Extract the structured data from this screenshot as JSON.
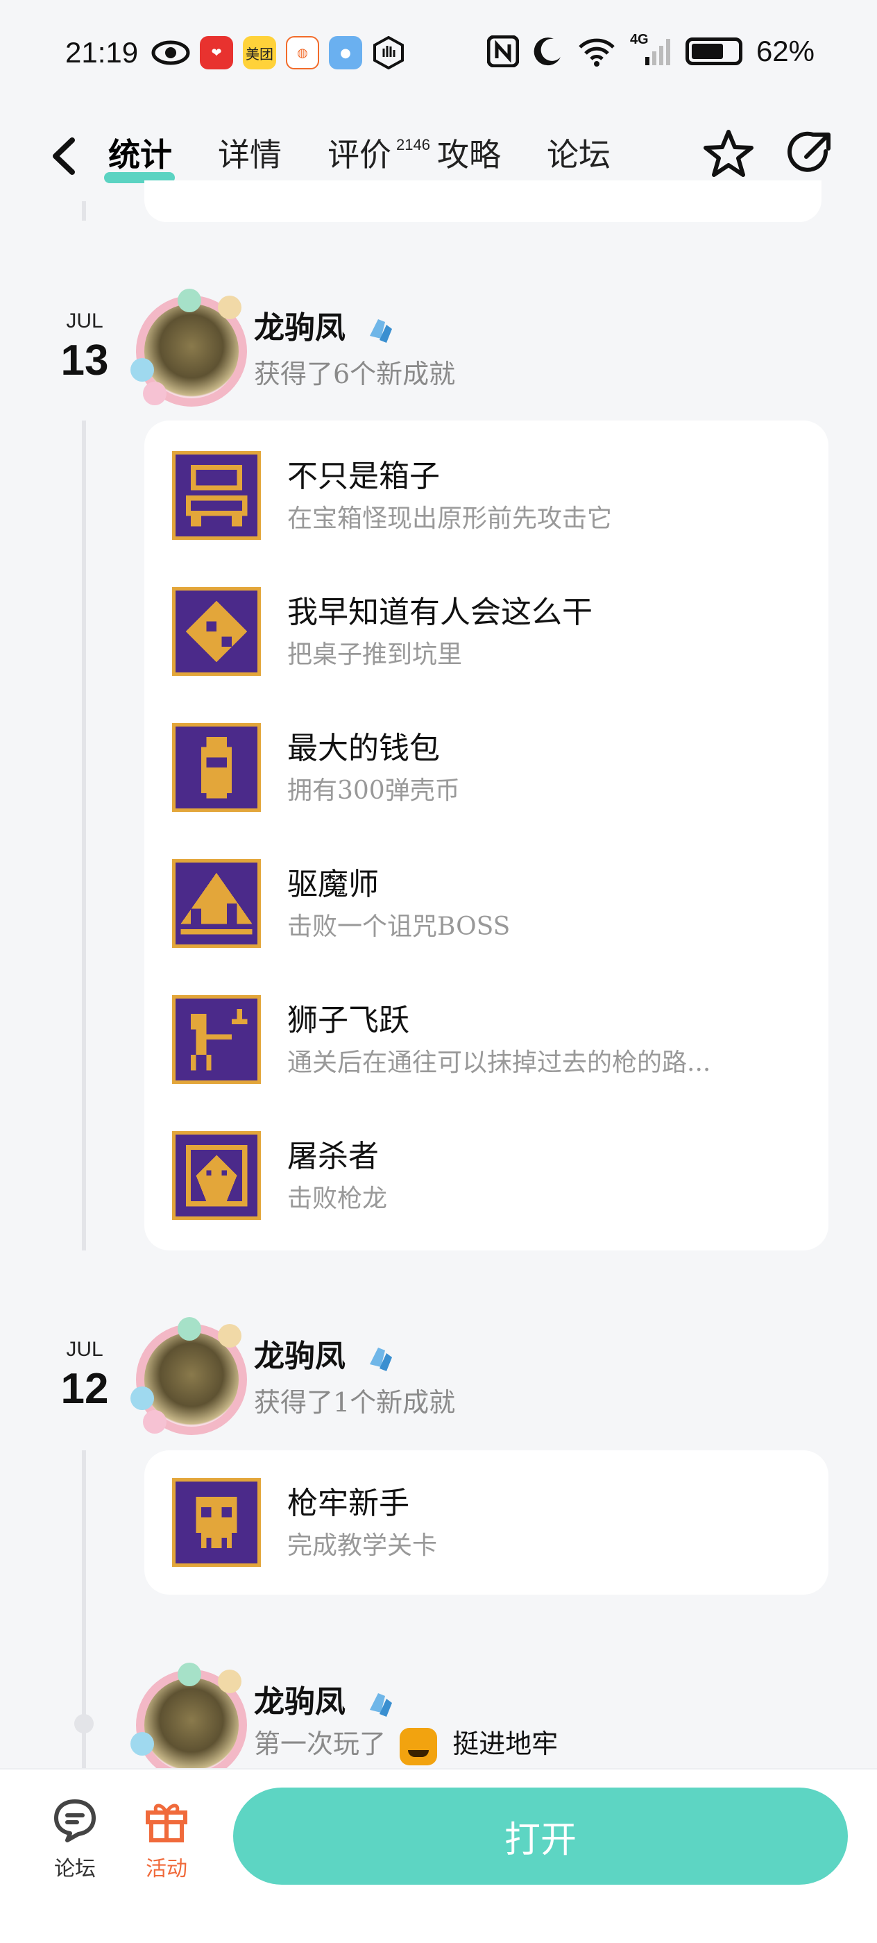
{
  "status_bar": {
    "time": "21:19",
    "apps": [
      "eye-icon",
      "red-app",
      "美团",
      "didi-app",
      "weather-app",
      "hand-icon"
    ],
    "network": "4G",
    "battery": "62%",
    "battery_level": 0.62
  },
  "nav": {
    "tabs": [
      {
        "label": "统计",
        "active": true
      },
      {
        "label": "详情"
      },
      {
        "label": "评价",
        "badge": "2146"
      },
      {
        "label": "攻略"
      },
      {
        "label": "论坛"
      }
    ]
  },
  "entries": [
    {
      "month": "JUL",
      "day": "13",
      "user": "龙驹凤",
      "summary": "获得了6个新成就",
      "achievements": [
        {
          "title": "不只是箱子",
          "desc": "在宝箱怪现出原形前先攻击它"
        },
        {
          "title": "我早知道有人会这么干",
          "desc": "把桌子推到坑里"
        },
        {
          "title": "最大的钱包",
          "desc": "拥有300弹壳币"
        },
        {
          "title": "驱魔师",
          "desc": "击败一个诅咒BOSS"
        },
        {
          "title": "狮子飞跃",
          "desc": "通关后在通往可以抹掉过去的枪的路..."
        },
        {
          "title": "屠杀者",
          "desc": "击败枪龙"
        }
      ]
    },
    {
      "month": "JUL",
      "day": "12",
      "user": "龙驹凤",
      "summary": "获得了1个新成就",
      "achievements": [
        {
          "title": "枪牢新手",
          "desc": "完成教学关卡"
        }
      ]
    },
    {
      "user": "龙驹凤",
      "summary_prefix": "第一次玩了",
      "game": "挺进地牢"
    }
  ],
  "bottom_bar": {
    "forum_label": "论坛",
    "activity_label": "活动",
    "open_label": "打开"
  },
  "colors": {
    "accent": "#5dd5c3",
    "activity": "#f06a3b",
    "icon_bg": "#4b2a8a",
    "icon_gold": "#e3a63a"
  }
}
